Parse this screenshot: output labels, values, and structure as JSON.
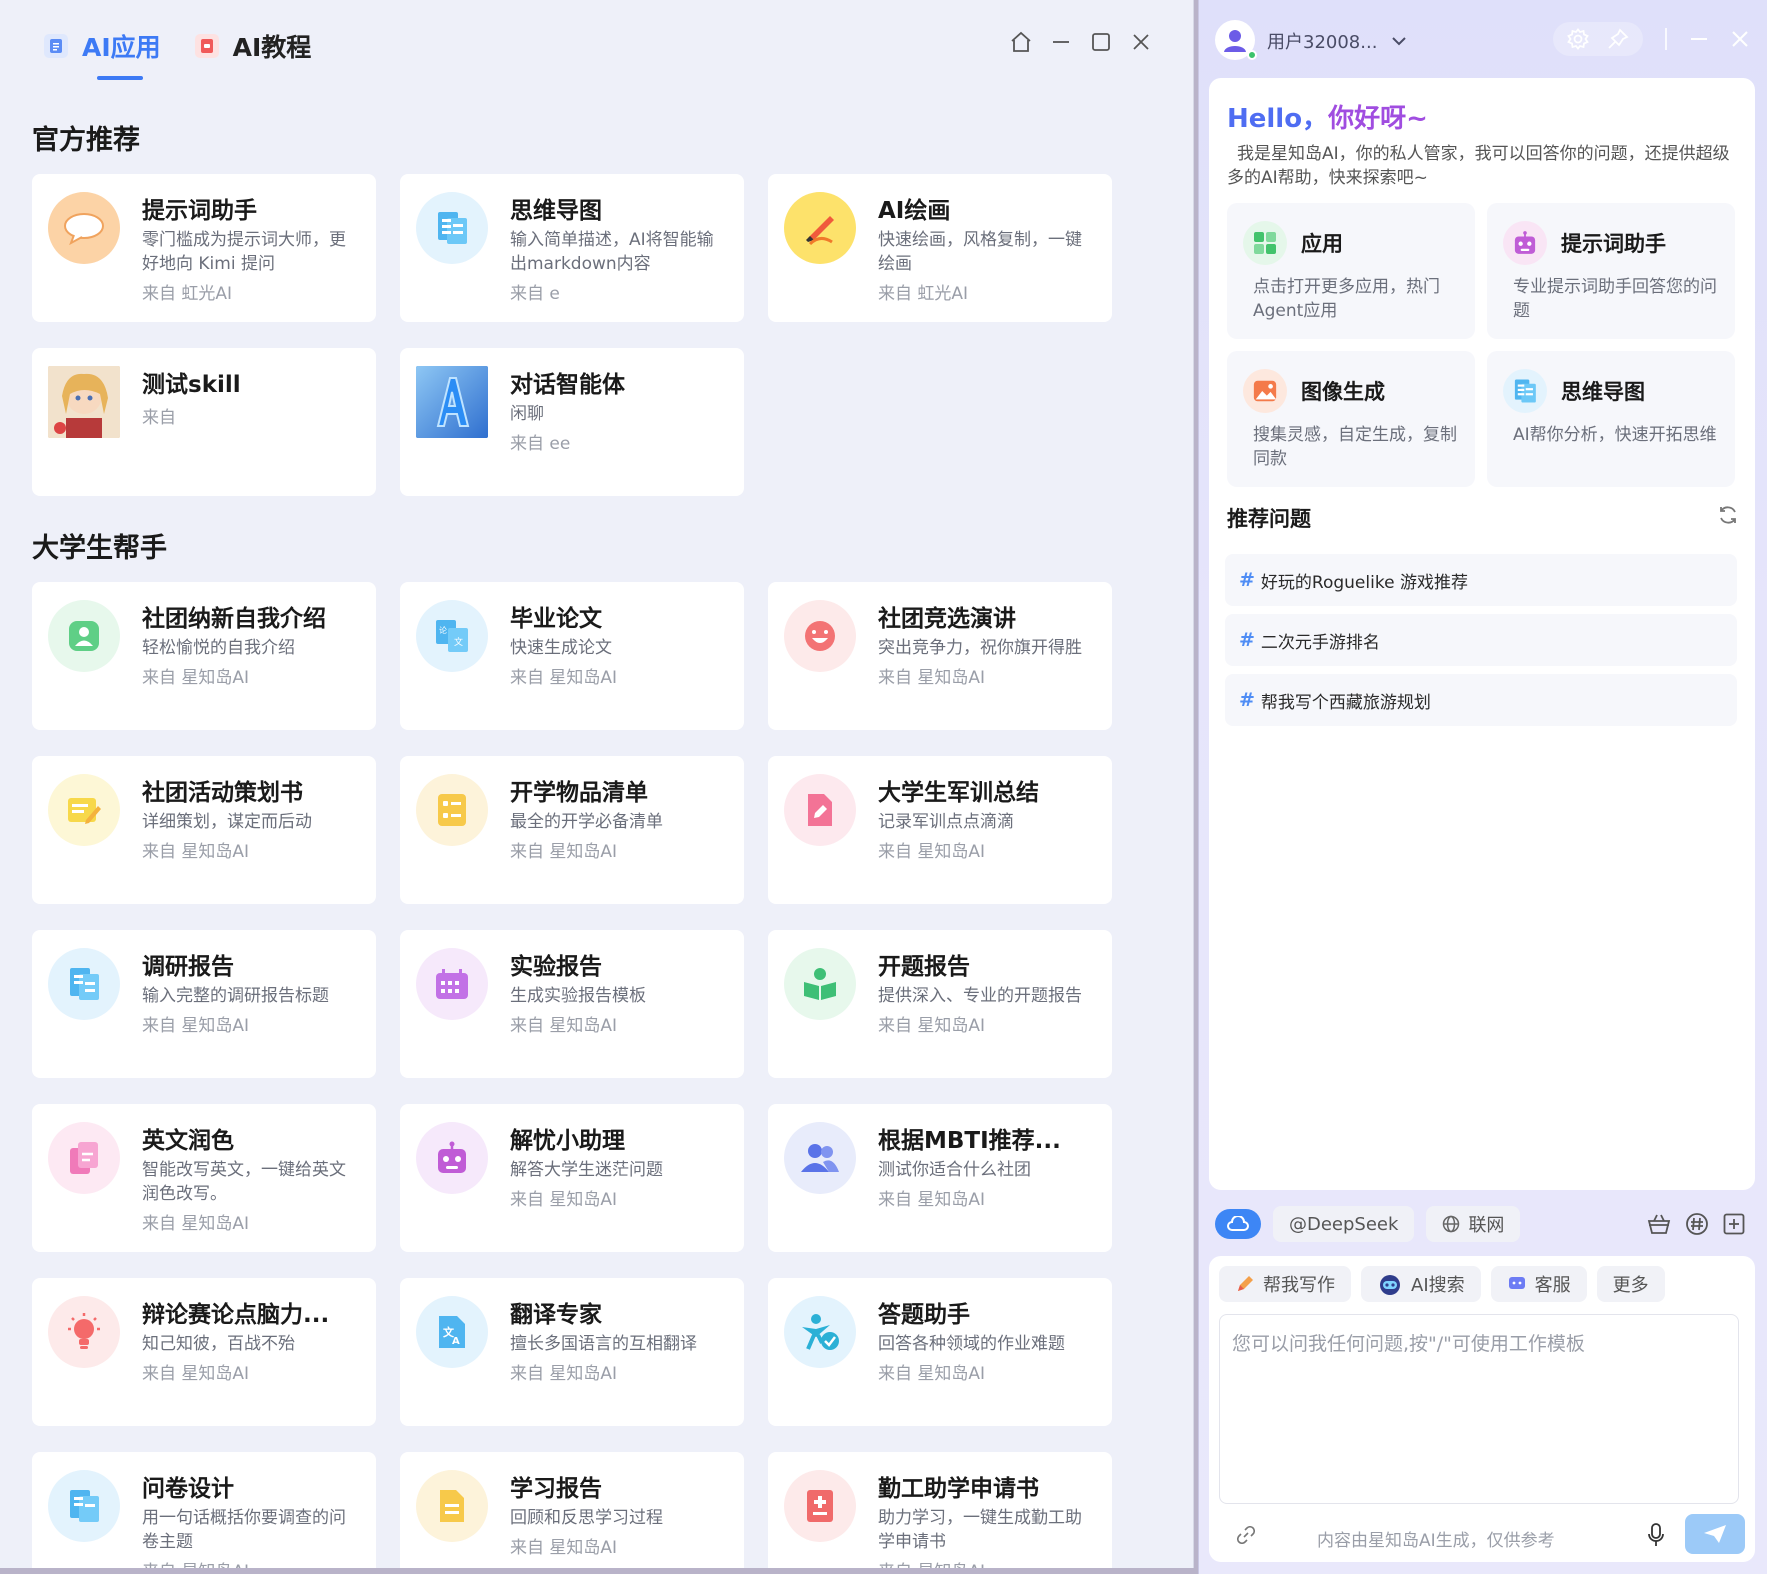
{
  "tabs": [
    {
      "label": "AI应用",
      "active": true,
      "icon": "doc-icon"
    },
    {
      "label": "AI教程",
      "active": false,
      "icon": "tutorial-icon"
    }
  ],
  "sections": [
    {
      "title": "官方推荐",
      "cards": [
        {
          "title": "提示词助手",
          "desc": "零门槛成为提示词大师，更好地向 Kimi 提问",
          "source": "来自 虹光AI",
          "icon": "chat-bubble-icon",
          "color": "#fcd3a6"
        },
        {
          "title": "思维导图",
          "desc": "输入简单描述，AI将智能输出markdown内容",
          "source": "来自 e",
          "icon": "mindmap-icon",
          "color": "#e3f3fd"
        },
        {
          "title": "AI绘画",
          "desc": "快速绘画，风格复制，一键绘画",
          "source": "来自 虹光AI",
          "icon": "paint-icon",
          "color": "#fde26b"
        },
        {
          "title": "测试skill",
          "desc": "",
          "source": "来自",
          "icon": "anime-avatar-icon",
          "color": "#e8c9a0"
        },
        {
          "title": "对话智能体",
          "desc": "闲聊",
          "source": "来自 ee",
          "icon": "letter-a-icon",
          "color": "#5aa0e6"
        }
      ]
    },
    {
      "title": "大学生帮手",
      "cards": [
        {
          "title": "社团纳新自我介绍",
          "desc": "轻松愉悦的自我介绍",
          "source": "来自 星知岛AI",
          "icon": "user-icon",
          "color": "#e7f8ec"
        },
        {
          "title": "毕业论文",
          "desc": "快速生成论文",
          "source": "来自 星知岛AI",
          "icon": "translate-doc-icon",
          "color": "#e3f3fd"
        },
        {
          "title": "社团竞选演讲",
          "desc": "突出竞争力，祝你旗开得胜",
          "source": "来自 星知岛AI",
          "icon": "smile-icon",
          "color": "#fdeaea"
        },
        {
          "title": "社团活动策划书",
          "desc": "详细策划，谋定而后动",
          "source": "来自 星知岛AI",
          "icon": "plan-icon",
          "color": "#fdf7d6"
        },
        {
          "title": "开学物品清单",
          "desc": "最全的开学必备清单",
          "source": "来自 星知岛AI",
          "icon": "list-icon",
          "color": "#fdf3da"
        },
        {
          "title": "大学生军训总结",
          "desc": "记录军训点点滴滴",
          "source": "来自 星知岛AI",
          "icon": "edit-doc-icon",
          "color": "#fde9ee"
        },
        {
          "title": "调研报告",
          "desc": "输入完整的调研报告标题",
          "source": "来自 星知岛AI",
          "icon": "report-icon",
          "color": "#e3f3fd"
        },
        {
          "title": "实验报告",
          "desc": "生成实验报告模板",
          "source": "来自 星知岛AI",
          "icon": "calendar-icon",
          "color": "#f6e9fb"
        },
        {
          "title": "开题报告",
          "desc": "提供深入、专业的开题报告",
          "source": "来自 星知岛AI",
          "icon": "book-reader-icon",
          "color": "#e7f8ec"
        },
        {
          "title": "英文润色",
          "desc": "智能改写英文，一键给英文润色改写。",
          "source": "来自 星知岛AI",
          "icon": "copy-icon",
          "color": "#fde9f3"
        },
        {
          "title": "解忧小助理",
          "desc": "解答大学生迷茫问题",
          "source": "来自 星知岛AI",
          "icon": "robot-icon",
          "color": "#f6e9fb"
        },
        {
          "title": "根据MBTI推荐...",
          "desc": "测试你适合什么社团",
          "source": "来自 星知岛AI",
          "icon": "group-icon",
          "color": "#e8ecfb"
        },
        {
          "title": "辩论赛论点脑力...",
          "desc": "知己知彼，百战不殆",
          "source": "来自 星知岛AI",
          "icon": "bulb-icon",
          "color": "#fdeaea"
        },
        {
          "title": "翻译专家",
          "desc": "擅长多国语言的互相翻译",
          "source": "来自 星知岛AI",
          "icon": "translate-icon",
          "color": "#e3f3fd"
        },
        {
          "title": "答题助手",
          "desc": "回答各种领域的作业难题",
          "source": "来自 星知岛AI",
          "icon": "check-person-icon",
          "color": "#e3f3fd"
        },
        {
          "title": "问卷设计",
          "desc": "用一句话概括你要调查的问卷主题",
          "source": "来自 星知岛AI",
          "icon": "survey-icon",
          "color": "#e3f3fd"
        },
        {
          "title": "学习报告",
          "desc": "回顾和反思学习过程",
          "source": "来自 星知岛AI",
          "icon": "study-doc-icon",
          "color": "#fdf3da"
        },
        {
          "title": "勤工助学申请书",
          "desc": "助力学习，一键生成勤工助学申请书",
          "source": "来自 星知岛AI",
          "icon": "apply-doc-icon",
          "color": "#fdeaea"
        }
      ]
    }
  ],
  "assistant": {
    "username": "用户32008...",
    "hello": "Hello，",
    "hello_highlight": "你好呀~",
    "intro": "我是星知岛AI，你的私人管家，我可以回答你的问题，还提供超级多的AI帮助，快来探索吧~",
    "quick_cards": [
      {
        "title": "应用",
        "desc": "点击打开更多应用，热门Agent应用",
        "icon": "apps-icon",
        "color": "#e5f7ea"
      },
      {
        "title": "提示词助手",
        "desc": "专业提示词助手回答您的问题",
        "icon": "robot-icon",
        "color": "#f9e5f5"
      },
      {
        "title": "图像生成",
        "desc": "搜集灵感，自定生成，复制同款",
        "icon": "image-icon",
        "color": "#fde8de"
      },
      {
        "title": "思维导图",
        "desc": "AI帮你分析，快速开拓思维",
        "icon": "mindmap-icon",
        "color": "#e3f3fd"
      }
    ],
    "recommend_title": "推荐问题",
    "recommend_items": [
      "好玩的Roguelike 游戏推荐",
      "二次元手游排名",
      "帮我写个西藏旅游规划"
    ],
    "model_chip": "@DeepSeek",
    "web_chip": "联网",
    "tools": [
      "帮我写作",
      "AI搜索",
      "客服",
      "更多"
    ],
    "input_placeholder": "您可以问我任何问题,按\"/\"可使用工作模板",
    "disclaimer": "内容由星知岛AI生成，仅供参考"
  }
}
